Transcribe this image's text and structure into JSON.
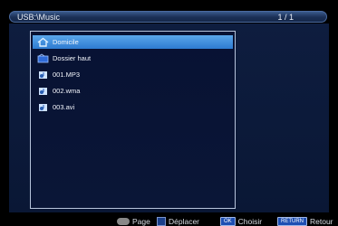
{
  "header": {
    "path": "USB:\\Music",
    "page_indicator": "1 / 1"
  },
  "file_list": [
    {
      "label": "Domicile",
      "icon": "home-icon",
      "selected": true
    },
    {
      "label": "Dossier haut",
      "icon": "folder-up-icon",
      "selected": false
    },
    {
      "label": "001.MP3",
      "icon": "music-file-icon",
      "selected": false
    },
    {
      "label": "002.wma",
      "icon": "music-file-icon",
      "selected": false
    },
    {
      "label": "003.avi",
      "icon": "music-file-icon",
      "selected": false
    }
  ],
  "footer": {
    "page_label": "Page",
    "move_label": "Déplacer",
    "ok_key": "OK",
    "choose_label": "Choisir",
    "return_key": "RETURN",
    "back_label": "Retour"
  },
  "colors": {
    "selection": "#3b8ee0",
    "panel_border": "#b7c4dc",
    "background": "#0a1735"
  }
}
